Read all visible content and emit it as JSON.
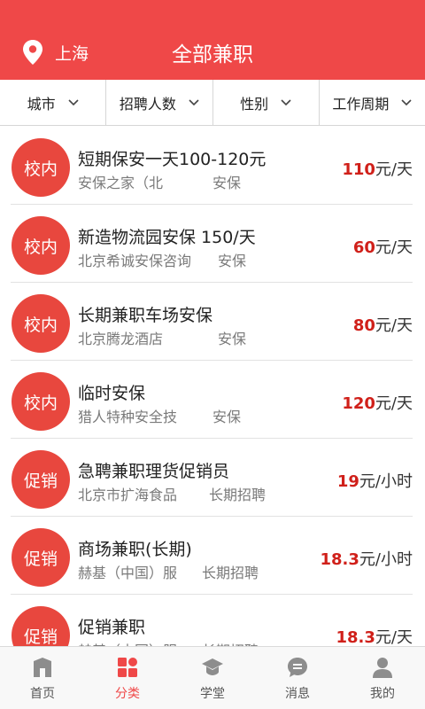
{
  "header": {
    "location": "上海",
    "title": "全部兼职",
    "location_icon": "location-pin-icon",
    "bg_color": "#ef4848"
  },
  "filters": [
    "城市",
    "招聘人数",
    "性别",
    "工作周期"
  ],
  "jobs": [
    {
      "badge": "校内",
      "title": "短期保安一天100-120元",
      "company": "安保之家（北",
      "tag": "安保",
      "price_num": "110",
      "price_unit": "元/天"
    },
    {
      "badge": "校内",
      "title": "新造物流园安保 150/天",
      "company": "北京希诚安保咨询",
      "tag": "安保",
      "price_num": "60",
      "price_unit": "元/天"
    },
    {
      "badge": "校内",
      "title": "长期兼职车场安保",
      "company": "北京腾龙酒店",
      "tag": "安保",
      "price_num": "80",
      "price_unit": "元/天"
    },
    {
      "badge": "校内",
      "title": "临时安保",
      "company": "猎人特种安全技",
      "tag": "安保",
      "price_num": "120",
      "price_unit": "元/天"
    },
    {
      "badge": "促销",
      "title": "急聘兼职理货促销员",
      "company": "北京市扩海食品",
      "tag": "长期招聘",
      "price_num": "19",
      "price_unit": "元/小时"
    },
    {
      "badge": "促销",
      "title": "商场兼职(长期)",
      "company": "赫基（中国）服",
      "tag": "长期招聘",
      "price_num": "18.3",
      "price_unit": "元/小时"
    },
    {
      "badge": "促销",
      "title": "促销兼职",
      "company": "赫基（中国）服",
      "tag": "长期招聘",
      "price_num": "18.3",
      "price_unit": "元/天"
    }
  ],
  "tabs": [
    {
      "label": "首页",
      "icon": "home-icon"
    },
    {
      "label": "分类",
      "icon": "category-icon",
      "active": true
    },
    {
      "label": "学堂",
      "icon": "graduation-cap-icon"
    },
    {
      "label": "消息",
      "icon": "message-icon"
    },
    {
      "label": "我的",
      "icon": "user-icon"
    }
  ],
  "colors": {
    "accent": "#ef4848",
    "price": "#d0201a",
    "badge": "#e8473e"
  }
}
